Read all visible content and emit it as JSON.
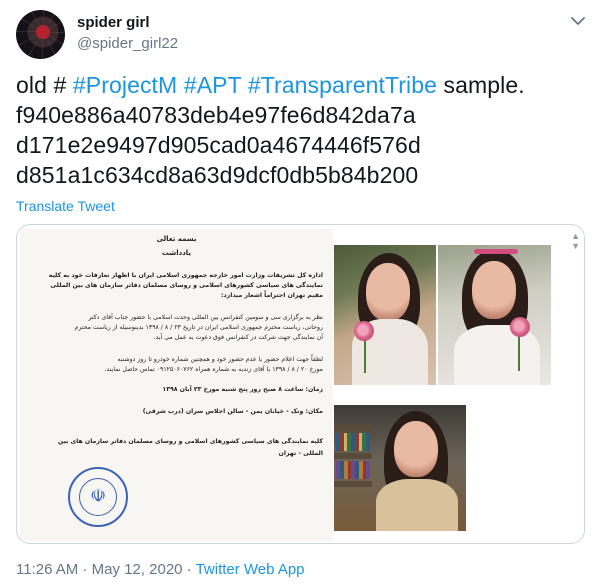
{
  "user": {
    "display_name": "spider girl",
    "handle": "@spider_girl22"
  },
  "tweet": {
    "line1_prefix": "old # ",
    "hashtags": [
      "#ProjectM",
      "#APT",
      "#TransparentTribe"
    ],
    "line1_suffix": " sample.",
    "hash_lines": [
      "f940e886a40783deb4e97fe6d842da7a",
      "d171e2e9497d905cad0a4674446f576d",
      "d851a1c634cd8a63d9dcf0db5b84b200"
    ]
  },
  "translate_label": "Translate Tweet",
  "media": {
    "document_lines": [
      "بسمه تعالی",
      "یادداشت",
      "اداره کل تشریفات وزارت امور خارجه جمهوری اسلامی ایران با اظهار تعارفات خود به کلیه",
      "نمایندگی های سیاسی کشورهای اسلامی و روسای مسلمان دفاتر سازمان های بین المللی",
      "مقیم تهران احتراماً اشعار میدارد:",
      "نظر به برگزاری سی و سومین کنفرانس بین المللی وحدت اسلامی با حضور جناب آقای دکتر",
      "روحانی، ریاست محترم جمهوری اسلامی ایران در تاریخ ۲۳ / ۸ / ۱۳۹۸ بدینوسیله از ریاست محترم",
      "آن نمایندگی جهت شرکت در کنفرانس فوق دعوت به عمل می آید.",
      "لطفاً جهت اعلام حضور یا عدم حضور خود و همچنین شماره خودرو تا روز دوشنبه",
      "مورخ ۲۰ / ۸ / ۱۳۹۸ با آقای زندیه به شماره همراه ۰۹۱۲۵۰۶۰۷۶۲ تماس حاصل نمایند.",
      "زمان: ساعت ۸ صبح روز پنج شنبه مورخ ۲۳ آبان ۱۳۹۸",
      "مکان: ونک - خیابان یمن - سالن اجلاس سران (درب شرقی)",
      "کلیه نمایندگی های سیاسی کشورهای اسلامی و روسای مسلمان دفاتر سازمان های بین",
      "المللی - تهران"
    ]
  },
  "timestamp": {
    "time": "11:26 AM",
    "sep1": " · ",
    "date": "May 12, 2020",
    "sep2": " · ",
    "app": "Twitter Web App"
  },
  "colors": {
    "link": "#1b95e0",
    "secondary_text": "#657786",
    "primary_text": "#14171a",
    "border": "#ccd6dd"
  },
  "icons": {
    "menu": "chevron-down-icon",
    "avatar": "spider-girl-avatar",
    "seal": "emblem-seal"
  }
}
